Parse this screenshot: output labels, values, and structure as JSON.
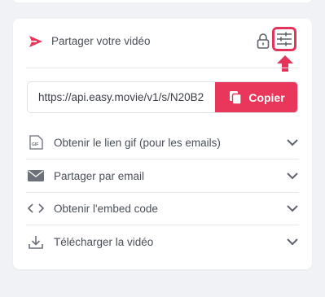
{
  "share": {
    "title": "Partager votre vidéo",
    "link_value": "https://api.easy.movie/v1/s/N20B2",
    "copy_label": "Copier"
  },
  "options": [
    {
      "label": "Obtenir le lien gif (pour les emails)",
      "icon": "gif-icon"
    },
    {
      "label": "Partager par email",
      "icon": "email-icon"
    },
    {
      "label": "Obtenir l'embed code",
      "icon": "code-icon"
    },
    {
      "label": "Télécharger la vidéo",
      "icon": "download-icon"
    }
  ],
  "colors": {
    "accent": "#e8375a",
    "highlight": "#e4345a",
    "text": "#4a4f57",
    "icon": "#6b7079"
  }
}
